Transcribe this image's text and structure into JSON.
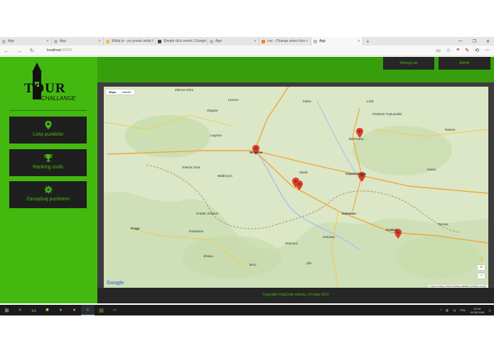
{
  "browser": {
    "tabs": [
      {
        "label": "App",
        "active": false
      },
      {
        "label": "App",
        "active": false
      },
      {
        "label": "Wklej.to - po prostu wklej t",
        "active": false
      },
      {
        "label": "Simple click event | Google",
        "active": false
      },
      {
        "label": "App",
        "active": false
      },
      {
        "label": "css - Change select box opt",
        "active": false
      },
      {
        "label": "App",
        "active": true
      }
    ],
    "url_host": "localhost",
    "url_port": ":52423"
  },
  "app": {
    "logo": {
      "line1": "TOUR",
      "line2": "CHALLANGE"
    },
    "sidebar": {
      "items": [
        {
          "label": "Lista punktów",
          "icon": "map-pin-icon"
        },
        {
          "label": "Ranking osób",
          "icon": "trophy-icon"
        },
        {
          "label": "Zarządzaj punktami",
          "icon": "gear-icon"
        }
      ]
    },
    "header": {
      "logout_label": "Wyloguj się",
      "admin_label": "Admin"
    },
    "map": {
      "type_map": "Mapa",
      "type_satellite": "Satelita",
      "zoom_in": "+",
      "zoom_out": "−",
      "google": "Google",
      "attribution": "Dane do Mapy ©2016 GeoBasis-DE/BKG (©2009), Google",
      "cities": [
        "Zielona Góra",
        "Leszno",
        "Kalisz",
        "Łódź",
        "Głogów",
        "Piotrków Trybunalski",
        "Legnica",
        "Wrocław",
        "Bełchatów",
        "Radom",
        "Jelenia Góra",
        "Wałbrzych",
        "Opole",
        "Częstochowa",
        "Kielce",
        "Praga",
        "Hradec Králové",
        "Katowice",
        "Kraków",
        "Ostrawa",
        "Pardubice",
        "Brno",
        "Olomouc",
        "Zlín",
        "Jihlava",
        "Tarnów"
      ]
    },
    "footer": "Copyright ©ngCode sobota, 14 maja 2016"
  },
  "taskbar": {
    "lang": "POL",
    "time": "12:10",
    "date": "14.05.2016"
  },
  "colors": {
    "accent": "#43b90f",
    "dark": "#262626",
    "marker": "#d9402c"
  }
}
